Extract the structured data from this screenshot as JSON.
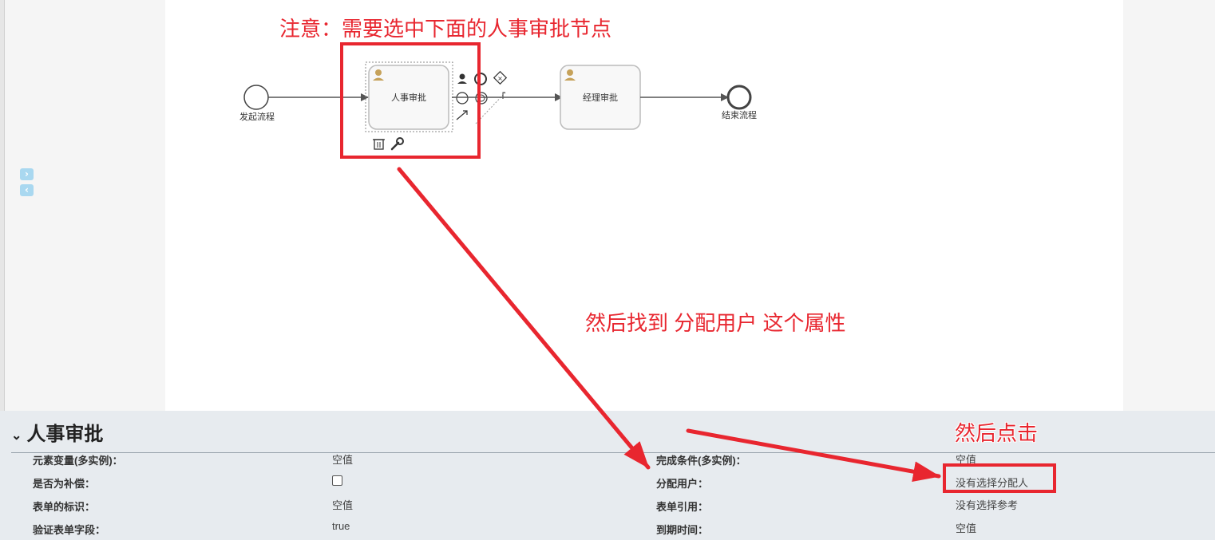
{
  "diagram": {
    "start_event_label": "发起流程",
    "task1_label": "人事审批",
    "task2_label": "经理审批",
    "end_event_label": "结束流程"
  },
  "properties": {
    "title": "人事审批",
    "rows": [
      {
        "label_left": "元素变量(多实例)：",
        "value_left": "空值",
        "label_right": "完成条件(多实例)：",
        "value_right": "空值"
      },
      {
        "label_left": "是否为补偿：",
        "value_left": "",
        "label_right": "分配用户：",
        "value_right": "没有选择分配人"
      },
      {
        "label_left": "表单的标识：",
        "value_left": "空值",
        "label_right": "表单引用：",
        "value_right": "没有选择参考"
      },
      {
        "label_left": "验证表单字段：",
        "value_left": "true",
        "label_right": "到期时间：",
        "value_right": "空值"
      }
    ]
  },
  "annotations": {
    "note1": "注意：需要选中下面的人事审批节点",
    "note2": "然后找到 分配用户 这个属性",
    "note3": "然后点击"
  },
  "colors": {
    "annotation_red": "#e8262f",
    "task_fill": "#f8f8f8",
    "panel_bg": "#e7ebef"
  },
  "icons": [
    "user-icon",
    "trash-icon",
    "wrench-icon",
    "expand-right-icon",
    "collapse-left-icon"
  ]
}
